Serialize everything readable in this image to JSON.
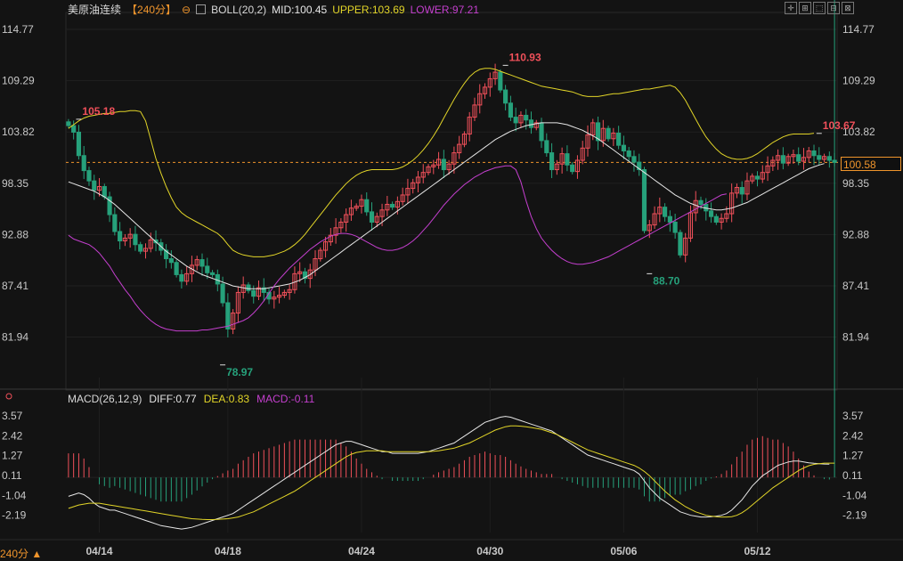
{
  "header": {
    "symbol": "美原油连续",
    "period": "【240分】",
    "boll_label": "BOLL(20,2)",
    "mid": "MID:100.45",
    "upper": "UPPER:103.69",
    "lower": "LOWER:97.21"
  },
  "macd_header": {
    "label": "MACD(26,12,9)",
    "diff": "DIFF:0.77",
    "dea": "DEA:0.83",
    "macd": "MACD:-0.11"
  },
  "toolbar": [
    "✛",
    "⊞",
    "⬚",
    "⊟",
    "⊠"
  ],
  "current_price": "100.58",
  "period_button": "240分",
  "colors": {
    "up": "#f0505a",
    "down": "#26a17b",
    "mid": "#e6e6e6",
    "upper": "#e2d528",
    "lower": "#c43fce",
    "accent": "#f0952c",
    "grid": "#2a2a2a"
  },
  "chart_data": [
    {
      "type": "candlestick",
      "ylim": [
        78.0,
        116.0
      ],
      "y_ticks": [
        "114.77",
        "109.29",
        "103.82",
        "98.35",
        "92.88",
        "87.41",
        "81.94"
      ],
      "x_ticks": [
        {
          "label": "04/14",
          "index": 6
        },
        {
          "label": "04/18",
          "index": 31
        },
        {
          "label": "04/24",
          "index": 57
        },
        {
          "label": "04/30",
          "index": 82
        },
        {
          "label": "05/06",
          "index": 108
        },
        {
          "label": "05/12",
          "index": 134
        }
      ],
      "annotations": [
        {
          "text": "105.18",
          "index": 2,
          "value": 105.18
        },
        {
          "text": "110.93",
          "index": 85,
          "value": 110.93
        },
        {
          "text": "78.97",
          "index": 30,
          "value": 78.97
        },
        {
          "text": "88.70",
          "index": 113,
          "value": 88.7
        },
        {
          "text": "103.67",
          "index": 146,
          "value": 103.67
        }
      ],
      "reference_price": 100.58,
      "close": [
        104.5,
        103.8,
        101.3,
        99.7,
        98.6,
        97.6,
        98.0,
        96.9,
        95.0,
        93.2,
        92.2,
        92.5,
        92.9,
        91.8,
        91.1,
        91.4,
        92.3,
        92.0,
        91.2,
        90.3,
        89.9,
        88.6,
        87.9,
        88.7,
        89.6,
        90.2,
        89.5,
        88.8,
        88.6,
        87.6,
        85.6,
        82.8,
        84.5,
        86.7,
        87.5,
        86.9,
        86.3,
        87.2,
        86.7,
        86.0,
        86.2,
        86.4,
        86.7,
        87.0,
        88.7,
        88.9,
        88.2,
        89.1,
        90.3,
        91.2,
        92.1,
        92.8,
        93.6,
        94.2,
        95.0,
        95.7,
        95.9,
        96.6,
        95.3,
        94.2,
        94.8,
        95.5,
        96.1,
        95.8,
        96.4,
        97.1,
        97.8,
        98.4,
        99.0,
        99.5,
        100.1,
        100.3,
        100.9,
        99.8,
        100.4,
        101.6,
        102.5,
        103.6,
        105.4,
        106.7,
        107.9,
        108.6,
        109.5,
        110.2,
        108.3,
        106.9,
        105.4,
        104.8,
        105.6,
        105.1,
        104.3,
        104.8,
        102.9,
        101.6,
        99.8,
        100.4,
        101.5,
        100.3,
        99.6,
        100.8,
        102.1,
        103.5,
        104.8,
        102.9,
        104.2,
        103.1,
        103.7,
        102.4,
        101.8,
        101.2,
        100.6,
        99.8,
        93.3,
        93.9,
        95.1,
        95.8,
        94.8,
        94.2,
        93.1,
        90.7,
        92.5,
        95.2,
        96.5,
        96.1,
        95.4,
        94.8,
        94.2,
        94.6,
        95.1,
        97.3,
        97.9,
        97.2,
        98.6,
        99.1,
        98.8,
        99.5,
        100.2,
        100.8,
        101.3,
        100.5,
        101.2,
        101.4,
        100.7,
        101.1,
        101.8,
        101.3,
        100.9,
        101.2,
        100.8,
        100.58
      ],
      "mid_band": [
        98.5,
        98.3,
        98.1,
        97.9,
        97.7,
        97.5,
        97.2,
        96.9,
        96.5,
        96.1,
        95.6,
        95.1,
        94.6,
        94.1,
        93.6,
        93.1,
        92.6,
        92.1,
        91.6,
        91.1,
        90.7,
        90.3,
        89.9,
        89.5,
        89.2,
        88.9,
        88.6,
        88.4,
        88.2,
        88.0,
        87.8,
        87.6,
        87.4,
        87.3,
        87.2,
        87.1,
        87.1,
        87.1,
        87.1,
        87.2,
        87.3,
        87.4,
        87.5,
        87.6,
        87.8,
        88.0,
        88.3,
        88.6,
        89.0,
        89.4,
        89.8,
        90.2,
        90.6,
        91.0,
        91.4,
        91.8,
        92.2,
        92.6,
        93.0,
        93.4,
        93.8,
        94.2,
        94.6,
        95.0,
        95.4,
        95.8,
        96.2,
        96.6,
        97.0,
        97.4,
        97.8,
        98.2,
        98.6,
        99.0,
        99.4,
        99.8,
        100.2,
        100.6,
        101.0,
        101.4,
        101.8,
        102.2,
        102.6,
        103.0,
        103.3,
        103.6,
        103.9,
        104.1,
        104.3,
        104.5,
        104.6,
        104.7,
        104.8,
        104.8,
        104.8,
        104.8,
        104.7,
        104.6,
        104.4,
        104.2,
        104.0,
        103.7,
        103.4,
        103.1,
        102.7,
        102.3,
        101.9,
        101.5,
        101.1,
        100.7,
        100.3,
        99.9,
        99.5,
        99.1,
        98.7,
        98.3,
        97.9,
        97.5,
        97.1,
        96.8,
        96.5,
        96.2,
        96.0,
        95.8,
        95.7,
        95.6,
        95.5,
        95.5,
        95.6,
        95.7,
        95.9,
        96.1,
        96.3,
        96.6,
        96.9,
        97.2,
        97.5,
        97.8,
        98.1,
        98.4,
        98.7,
        99.0,
        99.3,
        99.6,
        99.9,
        100.1,
        100.3,
        100.45
      ],
      "upper_band": [
        104.2,
        104.6,
        105.0,
        105.3,
        105.5,
        105.6,
        105.7,
        105.8,
        105.8,
        105.9,
        106.0,
        106.0,
        106.1,
        106.1,
        106.0,
        105.0,
        103.0,
        101.0,
        99.4,
        98.0,
        96.8,
        95.8,
        95.2,
        94.8,
        94.5,
        94.2,
        93.9,
        93.6,
        93.3,
        93.0,
        92.5,
        91.8,
        91.2,
        90.9,
        90.7,
        90.6,
        90.5,
        90.5,
        90.5,
        90.6,
        90.7,
        90.9,
        91.1,
        91.4,
        91.8,
        92.3,
        92.9,
        93.6,
        94.3,
        95.0,
        95.7,
        96.4,
        97.1,
        97.7,
        98.3,
        98.8,
        99.2,
        99.5,
        99.7,
        99.8,
        99.8,
        99.8,
        99.8,
        99.8,
        99.9,
        100.1,
        100.4,
        100.8,
        101.3,
        101.9,
        102.6,
        103.4,
        104.3,
        105.3,
        106.3,
        107.3,
        108.2,
        109.0,
        109.7,
        110.2,
        110.5,
        110.6,
        110.6,
        110.5,
        110.3,
        110.1,
        109.9,
        109.7,
        109.5,
        109.3,
        109.1,
        108.9,
        108.7,
        108.6,
        108.5,
        108.4,
        108.3,
        108.2,
        108.1,
        107.9,
        107.7,
        107.6,
        107.6,
        107.6,
        107.7,
        107.8,
        107.9,
        107.9,
        108.0,
        108.1,
        108.2,
        108.3,
        108.4,
        108.4,
        108.5,
        108.6,
        108.7,
        108.8,
        108.6,
        108.0,
        107.2,
        106.2,
        105.2,
        104.2,
        103.3,
        102.6,
        102.0,
        101.5,
        101.2,
        101.0,
        100.9,
        100.9,
        101.0,
        101.2,
        101.5,
        101.9,
        102.3,
        102.7,
        103.0,
        103.3,
        103.5,
        103.6,
        103.6,
        103.6,
        103.6,
        103.69
      ],
      "lower_band": [
        92.8,
        92.4,
        92.2,
        92.0,
        91.8,
        91.4,
        90.9,
        90.2,
        89.5,
        88.6,
        87.8,
        87.0,
        86.3,
        85.5,
        84.8,
        84.2,
        83.7,
        83.3,
        83.0,
        82.8,
        82.7,
        82.6,
        82.6,
        82.6,
        82.6,
        82.6,
        82.7,
        82.7,
        82.8,
        82.9,
        83.0,
        83.1,
        83.3,
        83.5,
        83.7,
        84.0,
        84.5,
        85.1,
        85.8,
        86.6,
        87.4,
        88.1,
        88.7,
        89.3,
        89.8,
        90.3,
        90.8,
        91.3,
        91.7,
        92.1,
        92.4,
        92.7,
        92.9,
        93.0,
        93.0,
        92.9,
        92.7,
        92.4,
        92.1,
        91.8,
        91.5,
        91.3,
        91.2,
        91.2,
        91.3,
        91.5,
        91.8,
        92.2,
        92.7,
        93.3,
        93.9,
        94.6,
        95.3,
        96.0,
        96.6,
        97.2,
        97.7,
        98.2,
        98.6,
        99.0,
        99.3,
        99.6,
        99.8,
        100.0,
        100.1,
        100.2,
        100.2,
        99.8,
        98.5,
        96.5,
        94.8,
        93.5,
        92.5,
        91.8,
        91.2,
        90.7,
        90.3,
        90.0,
        89.8,
        89.7,
        89.7,
        89.8,
        89.9,
        90.1,
        90.3,
        90.5,
        90.8,
        91.1,
        91.4,
        91.7,
        92.0,
        92.3,
        92.6,
        92.9,
        93.2,
        93.5,
        93.8,
        94.1,
        94.4,
        94.7,
        95.0,
        95.3,
        95.6,
        95.9,
        96.2,
        96.5,
        96.8,
        97.1,
        97.21
      ]
    },
    {
      "type": "macd",
      "ylim": [
        -3.2,
        4.2
      ],
      "y_ticks": [
        "3.57",
        "2.42",
        "1.27",
        "0.11",
        "-1.04",
        "-2.19"
      ],
      "diff": [
        -1.1,
        -1.0,
        -0.9,
        -1.0,
        -1.2,
        -1.5,
        -1.7,
        -1.8,
        -1.9,
        -1.9,
        -2.0,
        -2.1,
        -2.2,
        -2.3,
        -2.4,
        -2.5,
        -2.6,
        -2.7,
        -2.8,
        -2.85,
        -2.9,
        -2.95,
        -3.0,
        -2.95,
        -2.9,
        -2.8,
        -2.7,
        -2.6,
        -2.5,
        -2.4,
        -2.3,
        -2.2,
        -2.1,
        -1.9,
        -1.7,
        -1.5,
        -1.3,
        -1.1,
        -0.9,
        -0.7,
        -0.5,
        -0.3,
        -0.1,
        0.1,
        0.3,
        0.5,
        0.7,
        0.9,
        1.1,
        1.3,
        1.5,
        1.7,
        1.9,
        2.0,
        2.1,
        2.1,
        2.0,
        1.9,
        1.8,
        1.7,
        1.6,
        1.5,
        1.5,
        1.4,
        1.4,
        1.4,
        1.4,
        1.4,
        1.4,
        1.45,
        1.5,
        1.6,
        1.7,
        1.8,
        1.9,
        2.0,
        2.2,
        2.4,
        2.6,
        2.8,
        3.0,
        3.2,
        3.3,
        3.4,
        3.5,
        3.55,
        3.5,
        3.4,
        3.3,
        3.2,
        3.1,
        3.0,
        2.9,
        2.8,
        2.7,
        2.5,
        2.3,
        2.1,
        1.9,
        1.7,
        1.5,
        1.3,
        1.2,
        1.1,
        1.0,
        0.9,
        0.8,
        0.7,
        0.6,
        0.5,
        0.4,
        0.2,
        -0.2,
        -0.6,
        -0.9,
        -1.2,
        -1.4,
        -1.6,
        -1.8,
        -2.0,
        -2.1,
        -2.2,
        -2.25,
        -2.3,
        -2.3,
        -2.28,
        -2.25,
        -2.2,
        -2.1,
        -1.9,
        -1.6,
        -1.3,
        -0.9,
        -0.5,
        -0.2,
        0.1,
        0.3,
        0.5,
        0.7,
        0.8,
        0.9,
        0.95,
        0.95,
        0.9,
        0.85,
        0.82,
        0.8,
        0.78,
        0.77
      ],
      "dea": [
        -1.8,
        -1.7,
        -1.6,
        -1.55,
        -1.5,
        -1.5,
        -1.5,
        -1.55,
        -1.6,
        -1.65,
        -1.7,
        -1.75,
        -1.8,
        -1.85,
        -1.9,
        -1.95,
        -2.0,
        -2.05,
        -2.1,
        -2.15,
        -2.2,
        -2.25,
        -2.3,
        -2.35,
        -2.4,
        -2.42,
        -2.44,
        -2.45,
        -2.45,
        -2.44,
        -2.42,
        -2.4,
        -2.35,
        -2.3,
        -2.2,
        -2.1,
        -2.0,
        -1.85,
        -1.7,
        -1.55,
        -1.4,
        -1.25,
        -1.1,
        -0.95,
        -0.8,
        -0.6,
        -0.4,
        -0.2,
        0.0,
        0.2,
        0.4,
        0.6,
        0.8,
        1.0,
        1.2,
        1.35,
        1.45,
        1.5,
        1.55,
        1.55,
        1.55,
        1.55,
        1.5,
        1.5,
        1.5,
        1.5,
        1.5,
        1.5,
        1.5,
        1.5,
        1.5,
        1.52,
        1.55,
        1.6,
        1.65,
        1.7,
        1.8,
        1.9,
        2.0,
        2.15,
        2.3,
        2.45,
        2.6,
        2.75,
        2.85,
        2.95,
        3.0,
        3.0,
        2.98,
        2.95,
        2.9,
        2.85,
        2.8,
        2.7,
        2.6,
        2.5,
        2.35,
        2.2,
        2.05,
        1.9,
        1.75,
        1.6,
        1.5,
        1.4,
        1.3,
        1.2,
        1.1,
        1.0,
        0.9,
        0.8,
        0.7,
        0.55,
        0.35,
        0.1,
        -0.2,
        -0.5,
        -0.8,
        -1.05,
        -1.3,
        -1.5,
        -1.7,
        -1.85,
        -2.0,
        -2.1,
        -2.2,
        -2.25,
        -2.28,
        -2.3,
        -2.3,
        -2.28,
        -2.2,
        -2.05,
        -1.85,
        -1.6,
        -1.35,
        -1.1,
        -0.85,
        -0.6,
        -0.4,
        -0.2,
        0.0,
        0.2,
        0.4,
        0.55,
        0.68,
        0.76,
        0.8,
        0.83,
        0.83,
        0.83
      ]
    }
  ]
}
